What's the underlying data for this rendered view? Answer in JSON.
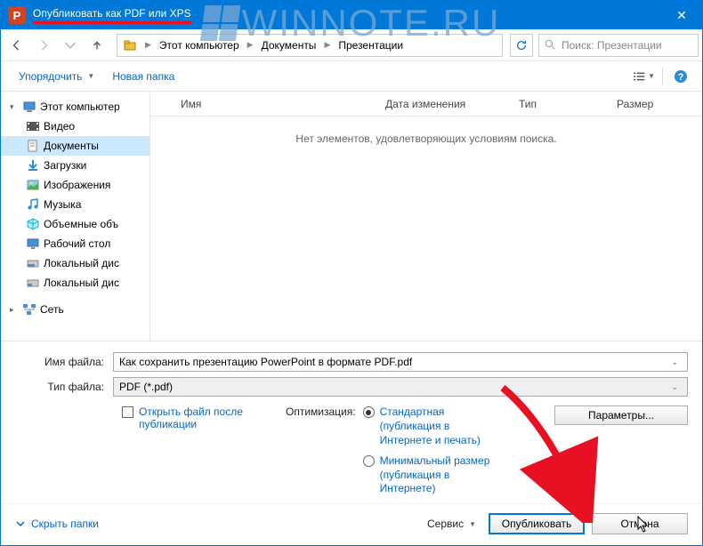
{
  "watermark": "WINNOTE.RU",
  "titlebar": {
    "title": "Опубликовать как PDF или XPS",
    "app_icon": "P"
  },
  "nav": {
    "path": [
      "Этот компьютер",
      "Документы",
      "Презентации"
    ],
    "search_placeholder": "Поиск: Презентации"
  },
  "toolbar": {
    "organize": "Упорядочить",
    "new_folder": "Новая папка"
  },
  "sidebar": {
    "this_pc": "Этот компьютер",
    "items": [
      {
        "label": "Видео"
      },
      {
        "label": "Документы",
        "selected": true
      },
      {
        "label": "Загрузки"
      },
      {
        "label": "Изображения"
      },
      {
        "label": "Музыка"
      },
      {
        "label": "Объемные объ"
      },
      {
        "label": "Рабочий стол"
      },
      {
        "label": "Локальный дис"
      },
      {
        "label": "Локальный дис"
      }
    ],
    "network": "Сеть"
  },
  "columns": {
    "name": "Имя",
    "date": "Дата изменения",
    "type": "Тип",
    "size": "Размер"
  },
  "empty": "Нет элементов, удовлетворяющих условиям поиска.",
  "filename": {
    "label": "Имя файла:",
    "value": "Как сохранить презентацию PowerPoint в формате PDF.pdf"
  },
  "filetype": {
    "label": "Тип файла:",
    "value": "PDF (*.pdf)"
  },
  "open_after": "Открыть файл после публикации",
  "optimization": {
    "label": "Оптимизация:",
    "standard": "Стандартная (публикация в Интернете и печать)",
    "minimal": "Минимальный размер (публикация в Интернете)"
  },
  "params": "Параметры...",
  "hide_folders": "Скрыть папки",
  "service": "Сервис",
  "publish": "Опубликовать",
  "cancel": "Отмена"
}
